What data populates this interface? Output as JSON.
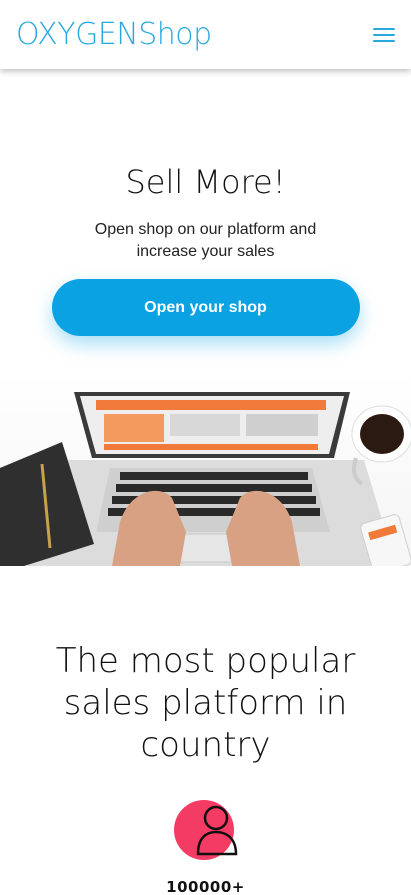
{
  "header": {
    "logo": "OXYGENShop",
    "menu_icon": "hamburger-menu-icon"
  },
  "hero": {
    "title": "Sell More!",
    "subtitle": "Open shop on our platform and increase your sales",
    "cta_label": "Open your shop"
  },
  "popular": {
    "title": "The most popular sales platform in country"
  },
  "stats": [
    {
      "icon": "user-icon",
      "value": "100000+"
    }
  ],
  "colors": {
    "brand": "#29a8df",
    "cta": "#0aa2e2",
    "stat_circle": "#f43b63"
  }
}
